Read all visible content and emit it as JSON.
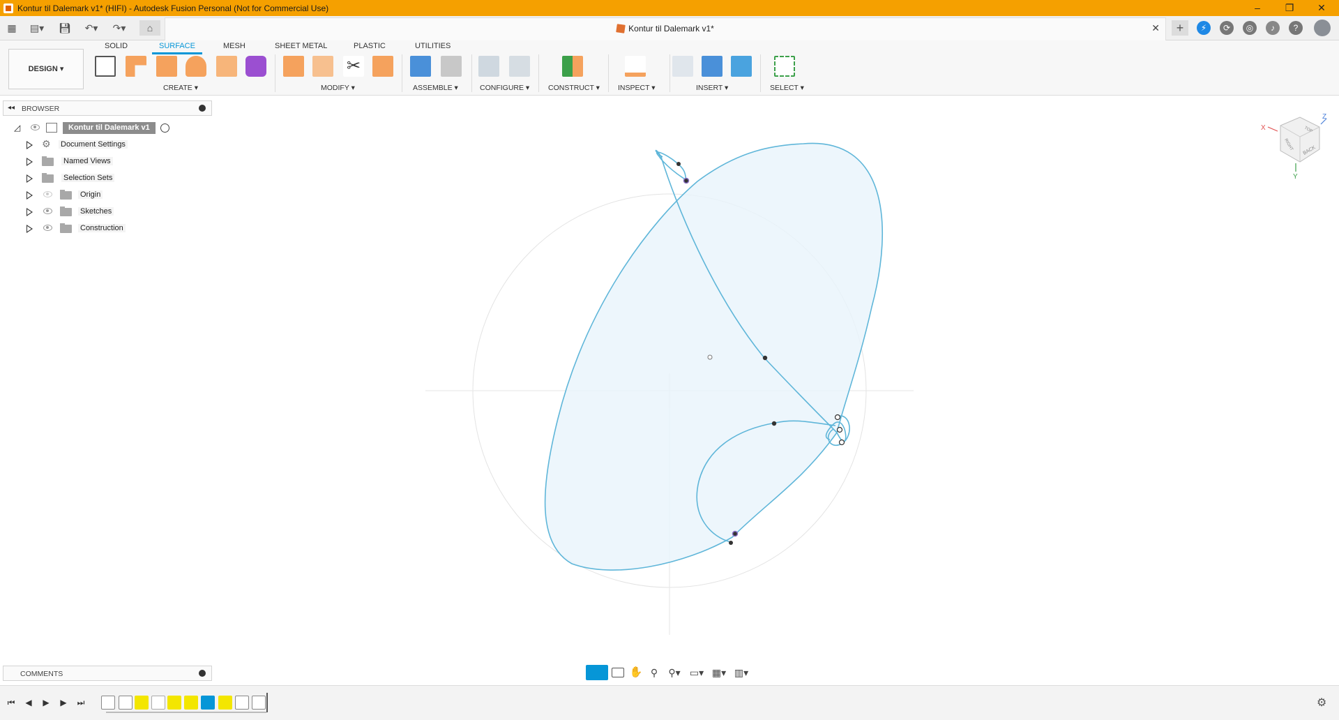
{
  "window": {
    "title": "Kontur til Dalemark v1* (HIFI) - Autodesk Fusion Personal (Not for Commercial Use)",
    "minimize": "–",
    "maximize": "❐",
    "close": "✕"
  },
  "document_tab": {
    "title": "Kontur til Dalemark v1*",
    "close": "✕"
  },
  "ribbon": {
    "tabs": [
      {
        "label": "SOLID",
        "active": false
      },
      {
        "label": "SURFACE",
        "active": true
      },
      {
        "label": "MESH",
        "active": false
      },
      {
        "label": "SHEET METAL",
        "active": false
      },
      {
        "label": "PLASTIC",
        "active": false
      },
      {
        "label": "UTILITIES",
        "active": false
      }
    ],
    "workspace": "DESIGN",
    "groups": [
      {
        "label": "CREATE"
      },
      {
        "label": "MODIFY"
      },
      {
        "label": "ASSEMBLE"
      },
      {
        "label": "CONFIGURE"
      },
      {
        "label": "CONSTRUCT"
      },
      {
        "label": "INSPECT"
      },
      {
        "label": "INSERT"
      },
      {
        "label": "SELECT"
      }
    ]
  },
  "browser": {
    "title": "BROWSER",
    "root": "Kontur til Dalemark v1",
    "items": [
      {
        "label": "Document Settings",
        "icon": "gear-icon"
      },
      {
        "label": "Named Views",
        "icon": "folder-icon"
      },
      {
        "label": "Selection Sets",
        "icon": "folder-icon"
      },
      {
        "label": "Origin",
        "icon": "folder-icon"
      },
      {
        "label": "Sketches",
        "icon": "folder-icon"
      },
      {
        "label": "Construction",
        "icon": "folder-icon"
      }
    ]
  },
  "comments": {
    "title": "COMMENTS"
  },
  "viewcube": {
    "faces": [
      "BACK",
      "RIGHT",
      "TOP"
    ],
    "axes": [
      "X",
      "Y",
      "Z"
    ]
  },
  "colors": {
    "titlebar": "#f5a000",
    "accent": "#0696d7",
    "sketch_line": "#5fb6d9",
    "sketch_fill": "#e8f4fb",
    "create_orange": "#f5a25d"
  }
}
